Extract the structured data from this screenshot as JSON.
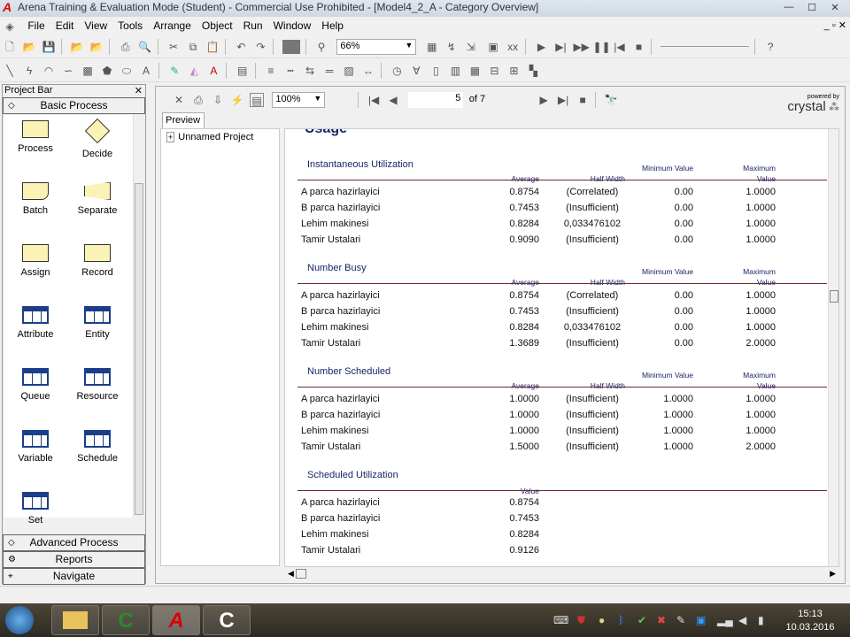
{
  "window": {
    "title": "Arena Training & Evaluation Mode (Student) - Commercial Use Prohibited - [Model4_2_A - Category Overview]"
  },
  "menu": [
    "File",
    "Edit",
    "View",
    "Tools",
    "Arrange",
    "Object",
    "Run",
    "Window",
    "Help"
  ],
  "toolbar": {
    "zoom": "66%"
  },
  "project_bar": {
    "title": "Project Bar",
    "panel": "Basic Process",
    "shapes": [
      "Process",
      "Decide",
      "Batch",
      "Separate",
      "Assign",
      "Record",
      "Attribute",
      "Entity",
      "Queue",
      "Resource",
      "Variable",
      "Schedule",
      "Set"
    ],
    "other_panels": [
      "Advanced Process",
      "Reports",
      "Navigate"
    ]
  },
  "report": {
    "zoom": "100%",
    "page": "5",
    "of": "of 7",
    "brand": "crystal",
    "brand_sub": "powered by",
    "tab": "Preview",
    "tree_item": "Unnamed Project",
    "heading": "Usage",
    "sections": [
      {
        "title": "Instantaneous Utilization",
        "cols": [
          "Average",
          "Half Width",
          "Minimum Value",
          "Maximum Value"
        ],
        "rows": [
          [
            "A parca hazirlayici",
            "0.8754",
            "(Correlated)",
            "0.00",
            "1.0000"
          ],
          [
            "B parca hazirlayici",
            "0.7453",
            "(Insufficient)",
            "0.00",
            "1.0000"
          ],
          [
            "Lehim makinesi",
            "0.8284",
            "0,033476102",
            "0.00",
            "1.0000"
          ],
          [
            "Tamir Ustalari",
            "0.9090",
            "(Insufficient)",
            "0.00",
            "1.0000"
          ]
        ]
      },
      {
        "title": "Number Busy",
        "cols": [
          "Average",
          "Half Width",
          "Minimum Value",
          "Maximum Value"
        ],
        "rows": [
          [
            "A parca hazirlayici",
            "0.8754",
            "(Correlated)",
            "0.00",
            "1.0000"
          ],
          [
            "B parca hazirlayici",
            "0.7453",
            "(Insufficient)",
            "0.00",
            "1.0000"
          ],
          [
            "Lehim makinesi",
            "0.8284",
            "0,033476102",
            "0.00",
            "1.0000"
          ],
          [
            "Tamir Ustalari",
            "1.3689",
            "(Insufficient)",
            "0.00",
            "2.0000"
          ]
        ]
      },
      {
        "title": "Number Scheduled",
        "cols": [
          "Average",
          "Half Width",
          "Minimum Value",
          "Maximum Value"
        ],
        "rows": [
          [
            "A parca hazirlayici",
            "1.0000",
            "(Insufficient)",
            "1.0000",
            "1.0000"
          ],
          [
            "B parca hazirlayici",
            "1.0000",
            "(Insufficient)",
            "1.0000",
            "1.0000"
          ],
          [
            "Lehim makinesi",
            "1.0000",
            "(Insufficient)",
            "1.0000",
            "1.0000"
          ],
          [
            "Tamir Ustalari",
            "1.5000",
            "(Insufficient)",
            "1.0000",
            "2.0000"
          ]
        ]
      },
      {
        "title": "Scheduled Utilization",
        "cols": [
          "Value"
        ],
        "rows": [
          [
            "A parca hazirlayici",
            "0.8754"
          ],
          [
            "B parca hazirlayici",
            "0.7453"
          ],
          [
            "Lehim makinesi",
            "0.8284"
          ],
          [
            "Tamir Ustalari",
            "0.9126"
          ]
        ]
      }
    ]
  },
  "taskbar": {
    "time": "15:13",
    "date": "10.03.2016"
  }
}
